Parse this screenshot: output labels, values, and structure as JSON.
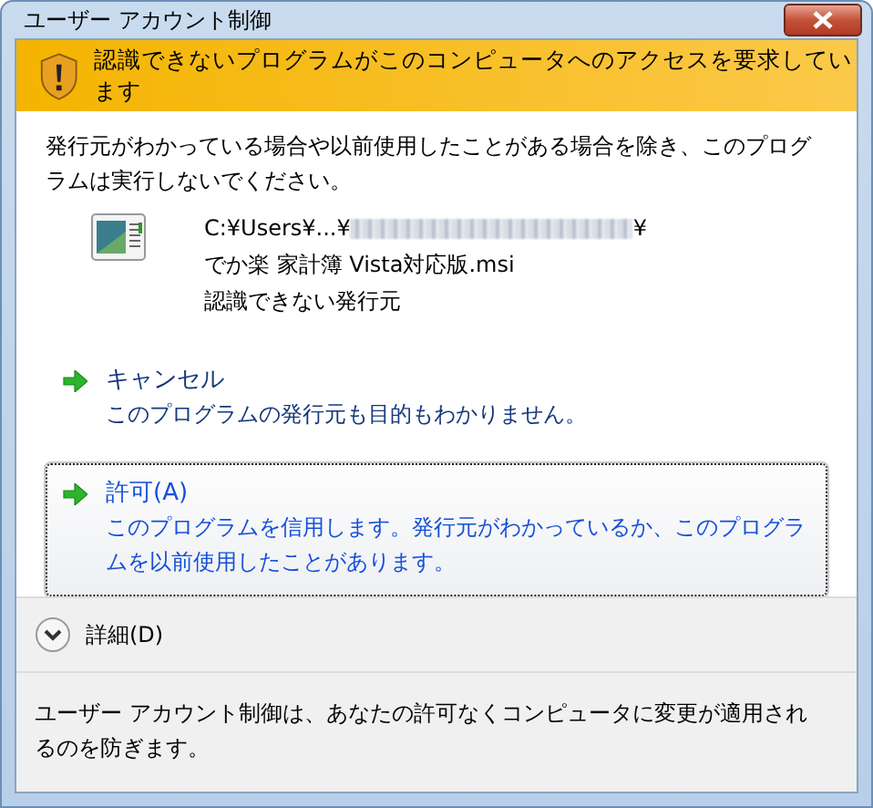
{
  "window": {
    "title": "ユーザー アカウント制御"
  },
  "banner": {
    "text": "認識できないプログラムがこのコンピュータへのアクセスを要求しています"
  },
  "intro": "発行元がわかっている場合や以前使用したことがある場合を除き、このプログラムは実行しないでください。",
  "program": {
    "path_start": "C:¥Users¥...¥",
    "path_end": "¥",
    "name": "でか楽 家計簿 Vista対応版.msi",
    "publisher": "認識できない発行元"
  },
  "options": [
    {
      "label": "キャンセル",
      "description": "このプログラムの発行元も目的もわかりません。",
      "selected": false
    },
    {
      "label": "許可(A)",
      "description": "このプログラムを信用します。発行元がわかっているか、このプログラムを以前使用したことがあります。",
      "selected": true
    }
  ],
  "details": {
    "label": "詳細(D)",
    "expanded": false
  },
  "footer": "ユーザー アカウント制御は、あなたの許可なくコンピュータに変更が適用されるのを防ぎます。"
}
